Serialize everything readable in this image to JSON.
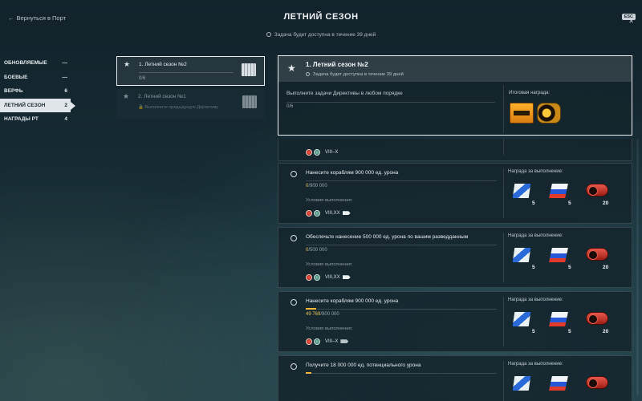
{
  "header": {
    "back_label": "Вернуться в Порт",
    "title": "ЛЕТНИЙ СЕЗОН",
    "subtitle": "Задача будет доступна в течение 39 дней",
    "esc_label": "ESC",
    "close_label": "✕"
  },
  "categories": [
    {
      "label": "ОБНОВЛЯЕМЫЕ",
      "count": "—"
    },
    {
      "label": "БОЕВЫЕ",
      "count": "—"
    },
    {
      "label": "ВЕРФЬ",
      "count": "6"
    },
    {
      "label": "ЛЕТНИЙ СЕЗОН",
      "count": "2"
    },
    {
      "label": "НАГРАДЫ РТ",
      "count": "4"
    }
  ],
  "directives": [
    {
      "name": "1. Летний сезон №2",
      "progress": "0/6"
    },
    {
      "name": "2. Летний сезон №1",
      "locked_text": "Выполните предыдущую Директиву"
    }
  ],
  "detail": {
    "title": "1. Летний сезон №2",
    "subtitle": "Задача будет доступна в течение 39 дней",
    "description": "Выполните задачи Директивы в любом порядке",
    "progress": "0/6",
    "reward_label": "Итоговая награда:"
  },
  "partial_task": {
    "tier": "VIII–X"
  },
  "tasks": [
    {
      "name": "Нанесите кораблям 900 000 ед. урона",
      "progress_current": "0",
      "progress_total": "/900 000",
      "progress_fraction": 0,
      "conditions_label": "Условия выполнения:",
      "tier": "VIII,XX",
      "reward_label": "Награда за выполнение:",
      "rewards": [
        "5",
        "5",
        "20"
      ]
    },
    {
      "name": "Обеспечьте нанесение 500 000 ед. урона по вашим разведданным",
      "progress_current": "0",
      "progress_total": "/500 000",
      "progress_fraction": 0,
      "conditions_label": "Условия выполнения:",
      "tier": "VIII,XX",
      "reward_label": "Награда за выполнение:",
      "rewards": [
        "5",
        "5",
        "20"
      ]
    },
    {
      "name": "Нанесите кораблям 900 000 ед. урона",
      "progress_current": "49 769",
      "progress_total": "/900 000",
      "progress_fraction": 0.055,
      "conditions_label": "Условия выполнения:",
      "tier": "VIII–X",
      "reward_label": "Награда за выполнение:",
      "rewards": [
        "5",
        "5",
        "20"
      ]
    },
    {
      "name": "Получите 18 000 000 ед. потенциального урона",
      "progress_current": "",
      "progress_total": "",
      "progress_fraction": 0.03,
      "conditions_label": "",
      "tier": "",
      "reward_label": "Награда за выполнение:",
      "rewards": []
    }
  ]
}
